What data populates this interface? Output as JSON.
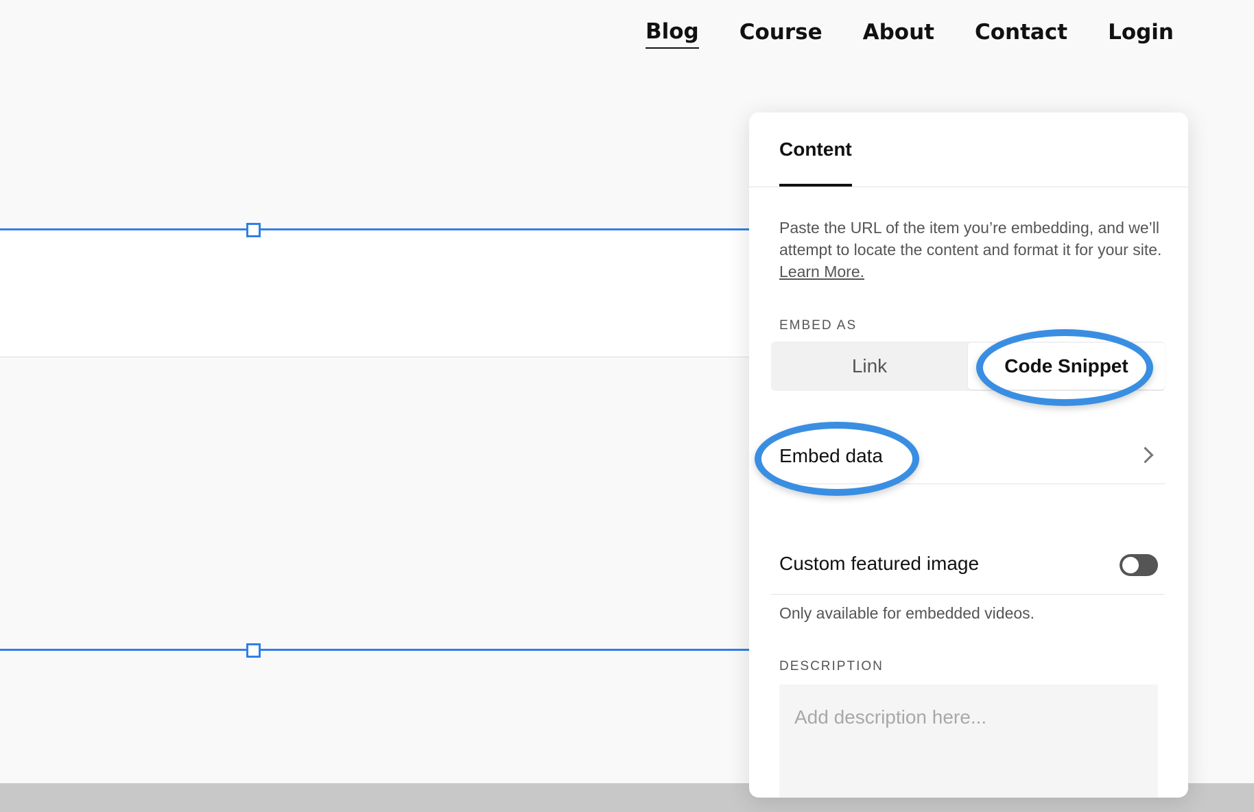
{
  "nav": {
    "items": [
      {
        "label": "Blog",
        "active": true
      },
      {
        "label": "Course",
        "active": false
      },
      {
        "label": "About",
        "active": false
      },
      {
        "label": "Contact",
        "active": false
      },
      {
        "label": "Login",
        "active": false
      }
    ]
  },
  "panel": {
    "tab": "Content",
    "intro_text": "Paste the URL of the item you’re embedding, and we’ll attempt to locate the content and format it for your site.",
    "learn_more": "Learn More.",
    "embed_as_label": "EMBED AS",
    "embed_options": {
      "link": "Link",
      "code_snippet": "Code Snippet",
      "selected": "Code Snippet"
    },
    "embed_data_label": "Embed data",
    "custom_image_label": "Custom featured image",
    "custom_image_enabled": false,
    "custom_image_helper": "Only available for embedded videos.",
    "description_label": "DESCRIPTION",
    "description_placeholder": "Add description here..."
  },
  "colors": {
    "accent": "#2f7fe6",
    "annotation": "#3a8ee2",
    "toggle_off": "#555555"
  }
}
